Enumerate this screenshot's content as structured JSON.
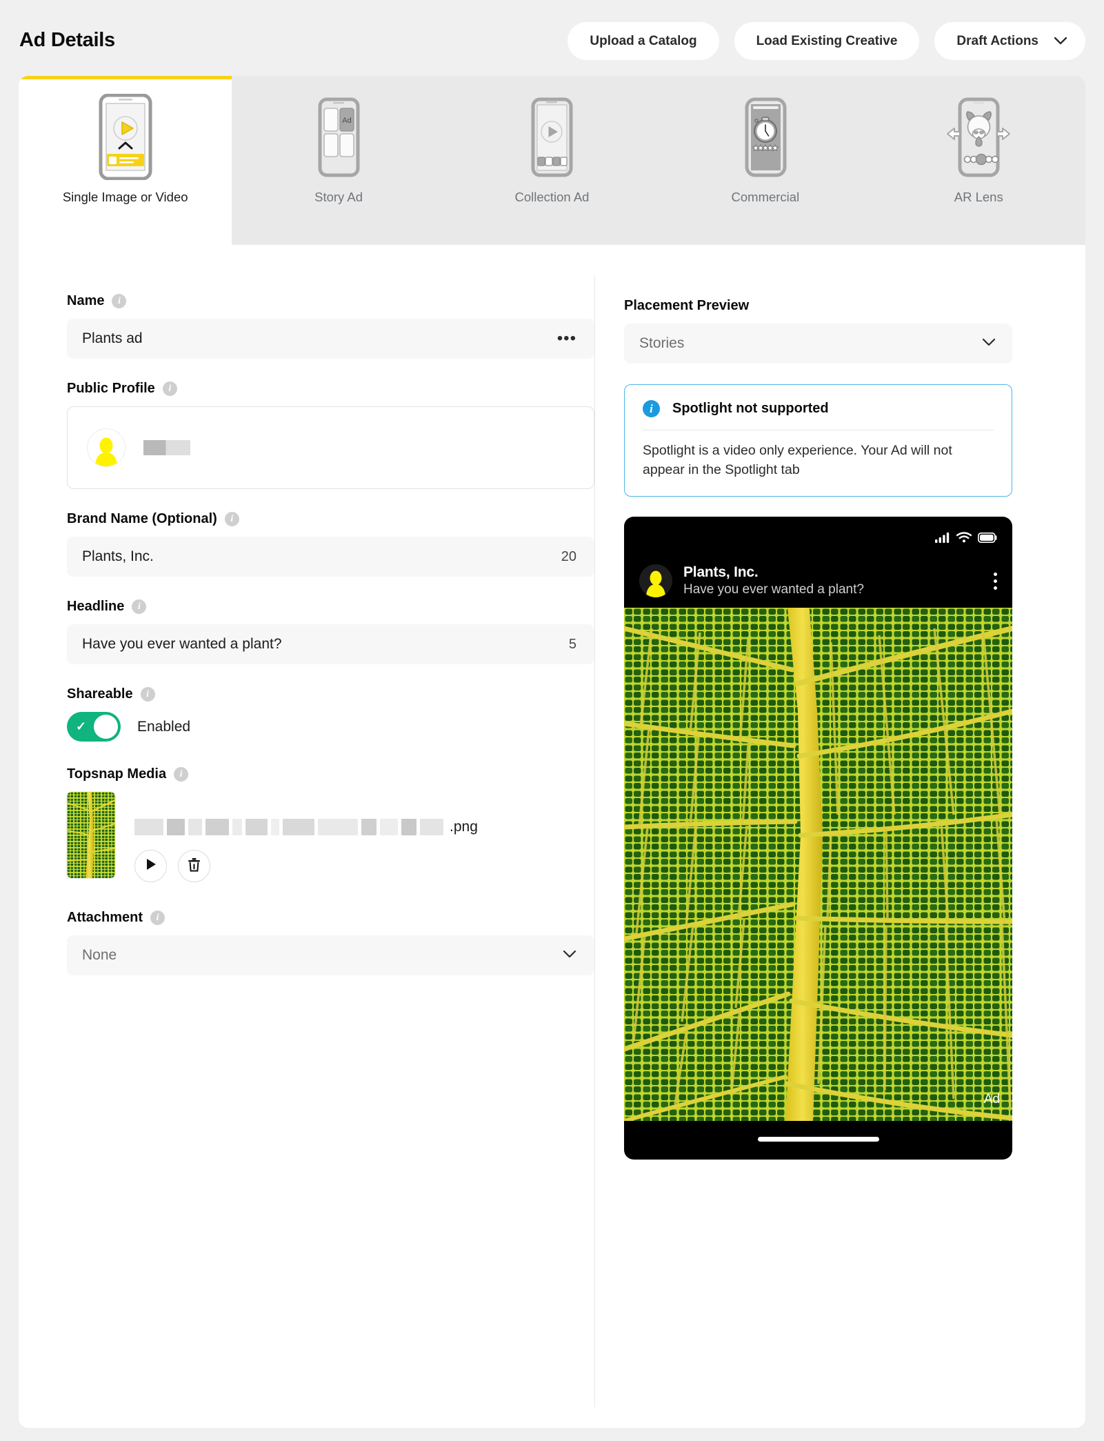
{
  "header": {
    "title": "Ad Details",
    "buttons": [
      {
        "label": "Upload a Catalog",
        "name": "upload-catalog-button"
      },
      {
        "label": "Load Existing Creative",
        "name": "load-existing-creative-button"
      },
      {
        "label": "Draft Actions",
        "name": "draft-actions-button",
        "caret": "⌄"
      }
    ]
  },
  "tabs": [
    {
      "label": "Single Image or Video",
      "icon": "single-image-video-icon",
      "active": true
    },
    {
      "label": "Story Ad",
      "icon": "story-ad-icon",
      "active": false
    },
    {
      "label": "Collection Ad",
      "icon": "collection-ad-icon",
      "active": false
    },
    {
      "label": "Commercial",
      "icon": "commercial-icon",
      "active": false
    },
    {
      "label": "AR Lens",
      "icon": "ar-lens-icon",
      "active": false
    }
  ],
  "form": {
    "name": {
      "label": "Name",
      "value": "Plants ad",
      "menu_glyph": "•••"
    },
    "public_profile": {
      "label": "Public Profile",
      "value": ""
    },
    "brand_name": {
      "label": "Brand Name (Optional)",
      "value": "Plants, Inc.",
      "counter": "20"
    },
    "headline": {
      "label": "Headline",
      "value": "Have you ever wanted a plant?",
      "counter": "5"
    },
    "shareable": {
      "label": "Shareable",
      "state": "Enabled",
      "on": true,
      "check_glyph": "✓"
    },
    "topsnap_media": {
      "label": "Topsnap Media",
      "filename_extension": ".png"
    },
    "attachment": {
      "label": "Attachment",
      "value": "None",
      "caret": "⌄"
    }
  },
  "preview": {
    "label": "Placement Preview",
    "placement": "Stories",
    "caret": "⌄",
    "notice": {
      "title": "Spotlight not supported",
      "body": "Spotlight is a video only experience. Your Ad will not appear in the Spotlight tab",
      "icon": "i"
    },
    "phone": {
      "brand": "Plants, Inc.",
      "headline": "Have you ever wanted a plant?",
      "ad_tag": "Ad"
    }
  },
  "colors": {
    "accent_yellow": "#f7d117",
    "toggle_green": "#0fb47e",
    "notice_blue": "#1a9ae0",
    "page_bg": "#f0f0f0",
    "card_bg": "#ffffff",
    "tabbar_bg": "#e9e9e9"
  }
}
